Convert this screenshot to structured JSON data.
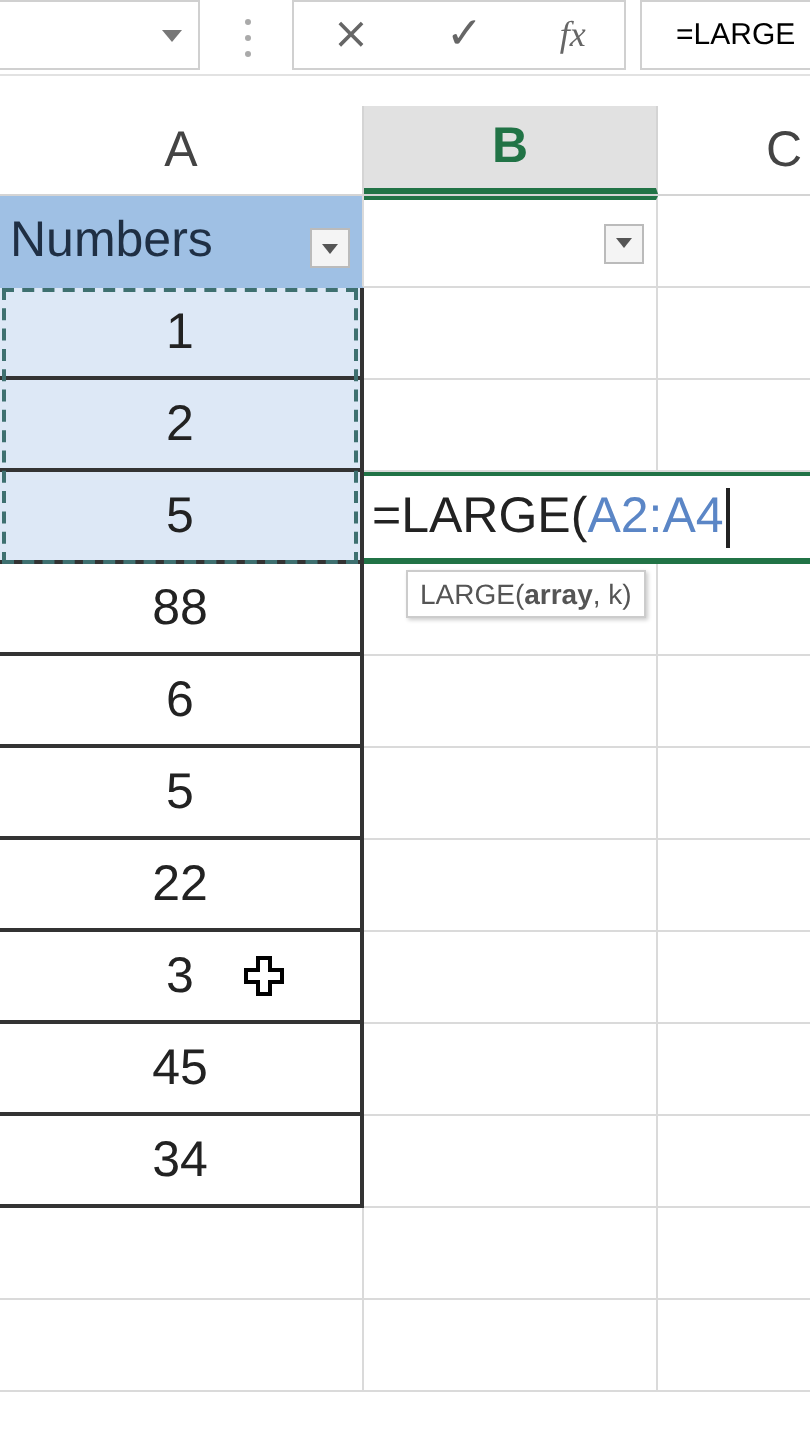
{
  "formula_bar": {
    "cancel": "×",
    "enter": "✓",
    "function": "fx",
    "formula": "=LARGE"
  },
  "columns": [
    {
      "label": "A",
      "selected": false
    },
    {
      "label": "B",
      "selected": true
    },
    {
      "label": "C",
      "selected": false
    }
  ],
  "table": {
    "header": "Numbers",
    "rows": [
      {
        "a": "1",
        "selected": true,
        "editing": false,
        "pointer": false
      },
      {
        "a": "2",
        "selected": true,
        "editing": false,
        "pointer": false
      },
      {
        "a": "5",
        "selected": true,
        "editing": true,
        "pointer": false
      },
      {
        "a": "88",
        "selected": false,
        "editing": false,
        "pointer": false
      },
      {
        "a": "6",
        "selected": false,
        "editing": false,
        "pointer": false
      },
      {
        "a": "5",
        "selected": false,
        "editing": false,
        "pointer": false
      },
      {
        "a": "22",
        "selected": false,
        "editing": false,
        "pointer": false
      },
      {
        "a": "3",
        "selected": false,
        "editing": false,
        "pointer": true
      },
      {
        "a": "45",
        "selected": false,
        "editing": false,
        "pointer": false
      },
      {
        "a": "34",
        "selected": false,
        "editing": false,
        "pointer": false
      }
    ]
  },
  "editor": {
    "text": "=LARGE(",
    "reference": "A2:A4",
    "tooltip": "LARGE(**array**, k)"
  }
}
